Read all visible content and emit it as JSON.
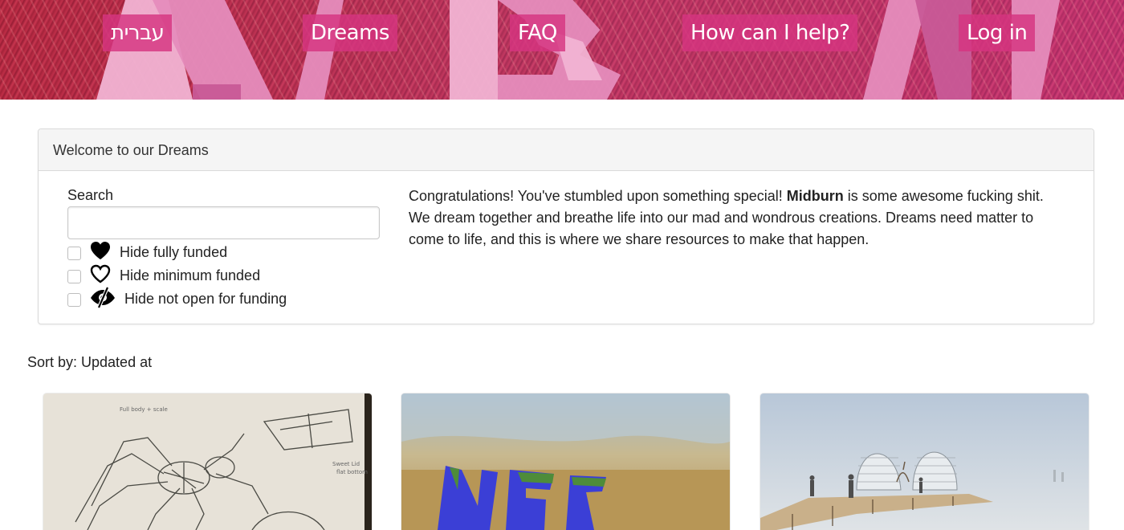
{
  "nav": {
    "hebrew": "עברית",
    "dreams": "Dreams",
    "faq": "FAQ",
    "help": "How can I help?",
    "login": "Log in"
  },
  "panel": {
    "title": "Welcome to our Dreams",
    "search_label": "Search",
    "search_value": "",
    "filters": [
      {
        "label": "Hide fully funded",
        "icon": "heart-filled-icon",
        "checked": false
      },
      {
        "label": "Hide minimum funded",
        "icon": "heart-outline-icon",
        "checked": false
      },
      {
        "label": "Hide not open for funding",
        "icon": "eye-slash-icon",
        "checked": false
      }
    ],
    "intro_before": "Congratulations! You've stumbled upon something special! ",
    "intro_bold": "Midburn",
    "intro_after": " is some awesome fucking shit. We dream together and breathe life into our mad and wondrous creations. Dreams need matter to come to life, and this is where we share resources to make that happen."
  },
  "sort": {
    "label": "Sort by: Updated at"
  },
  "cards": [
    {
      "image": "spider-sketch-image"
    },
    {
      "image": "desert-letters-image"
    },
    {
      "image": "dome-structure-image"
    }
  ],
  "colors": {
    "nav_bg": "#d63480",
    "banner_overlay": "#c8284c"
  }
}
